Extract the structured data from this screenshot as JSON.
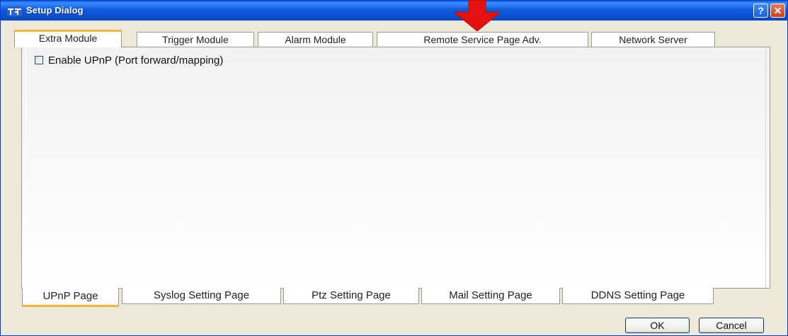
{
  "window": {
    "title": "Setup Dialog",
    "help_label": "?",
    "close_label": "✕"
  },
  "top_tabs": [
    {
      "label": "Extra Module",
      "active": true
    },
    {
      "label": "Trigger Module",
      "active": false
    },
    {
      "label": "Alarm Module",
      "active": false
    },
    {
      "label": "Remote Service Page Adv.",
      "active": false
    },
    {
      "label": "Network Server",
      "active": false
    }
  ],
  "content": {
    "upnp_checkbox": {
      "label": "Enable UPnP (Port forward/mapping)",
      "checked": false
    }
  },
  "bottom_tabs": [
    {
      "label": "UPnP Page",
      "active": true
    },
    {
      "label": "Syslog Setting Page",
      "active": false
    },
    {
      "label": "Ptz Setting Page",
      "active": false
    },
    {
      "label": "Mail Setting Page",
      "active": false
    },
    {
      "label": "DDNS Setting Page",
      "active": false
    }
  ],
  "buttons": {
    "ok": "OK",
    "cancel": "Cancel"
  },
  "colors": {
    "title_bar": "#0A4FCF",
    "active_tab_accent": "#F6B53A",
    "annotation_arrow": "#E3110F",
    "dialog_background": "#ECE9D8"
  }
}
